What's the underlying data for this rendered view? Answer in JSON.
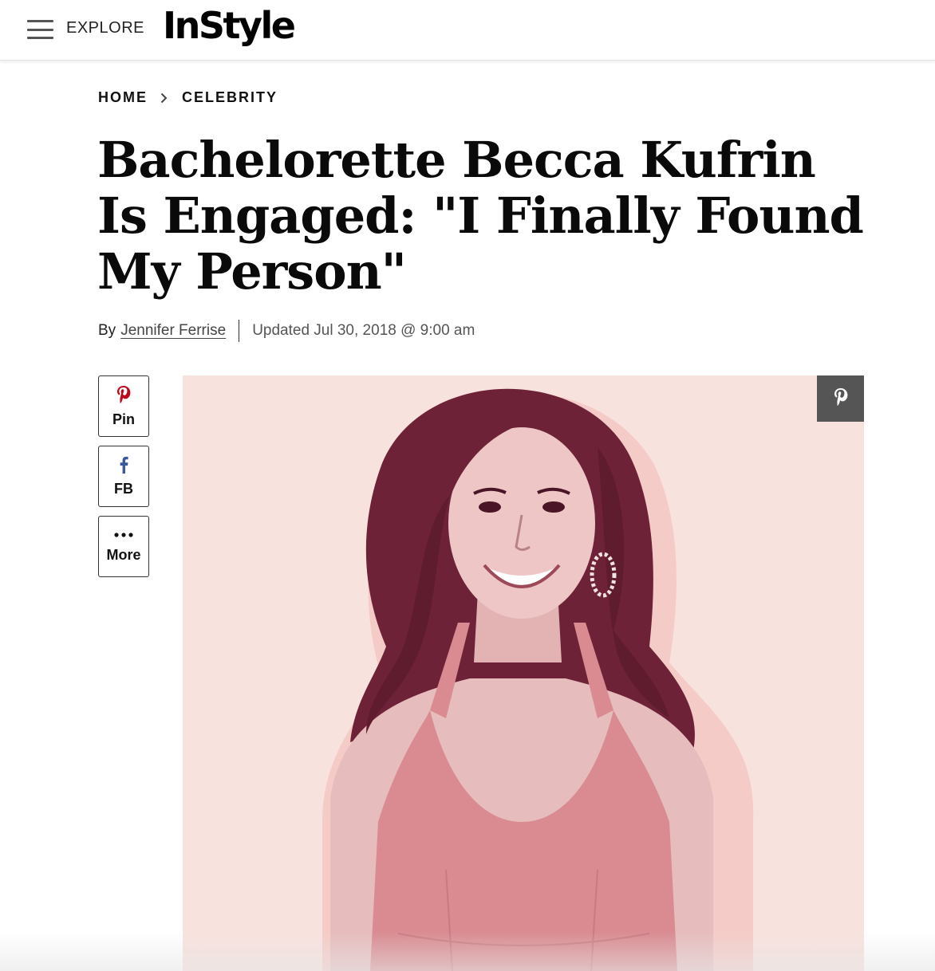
{
  "header": {
    "explore_label": "EXPLORE",
    "logo_text": "InStyle"
  },
  "breadcrumb": {
    "items": [
      "HOME",
      "CELEBRITY"
    ]
  },
  "article": {
    "title": "Bachelorette Becca Kufrin Is Engaged: \"I Finally Found My Person\"",
    "byline_prefix": "By",
    "author": "Jennifer Ferrise",
    "updated": "Updated Jul 30, 2018 @ 9:00 am"
  },
  "share": {
    "pin_label": "Pin",
    "fb_label": "FB",
    "more_label": "More"
  },
  "colors": {
    "pinterest_red": "#bd081c",
    "facebook_blue": "#3b5998",
    "hero_background": "#f8e2de",
    "hero_duotone_dark": "#6e2237",
    "dress_pink": "#d98b91"
  },
  "icons": [
    "hamburger-menu-icon",
    "chevron-right-icon",
    "pinterest-icon",
    "facebook-icon",
    "more-dots-icon"
  ]
}
